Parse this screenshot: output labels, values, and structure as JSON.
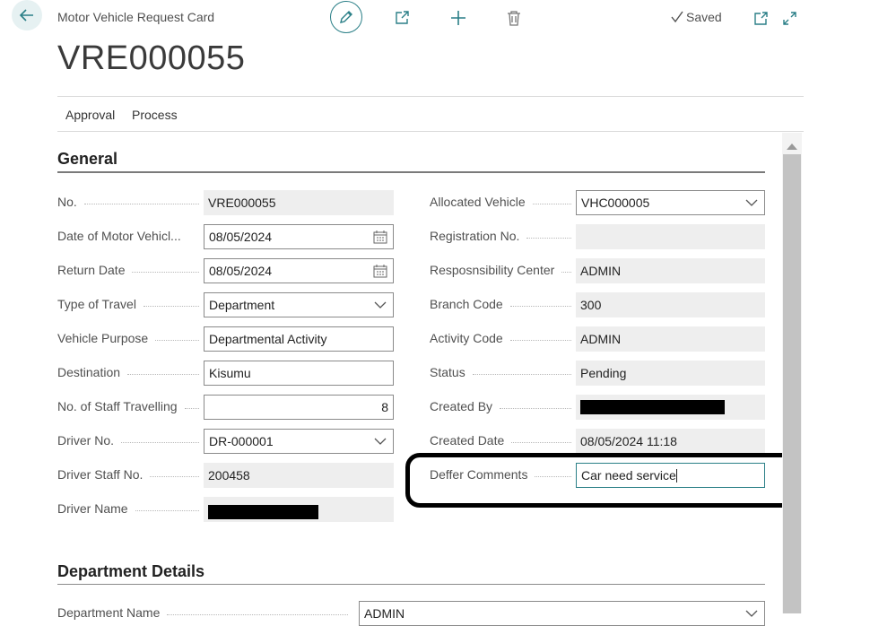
{
  "header": {
    "page_caption": "Motor Vehicle Request Card",
    "saved_label": "Saved",
    "record_title": "VRE000055"
  },
  "actions": {
    "approval": "Approval",
    "process": "Process"
  },
  "general": {
    "title": "General",
    "left": [
      {
        "label": "No.",
        "value": "VRE000055"
      },
      {
        "label": "Date of Motor Vehicl...",
        "value": "08/05/2024"
      },
      {
        "label": "Return Date",
        "value": "08/05/2024"
      },
      {
        "label": "Type of Travel",
        "value": "Department"
      },
      {
        "label": "Vehicle Purpose",
        "value": "Departmental Activity"
      },
      {
        "label": "Destination",
        "value": "Kisumu"
      },
      {
        "label": "No. of Staff Travelling",
        "value": "8"
      },
      {
        "label": "Driver No.",
        "value": "DR-000001"
      },
      {
        "label": "Driver Staff No.",
        "value": "200458"
      },
      {
        "label": "Driver Name",
        "value": ""
      }
    ],
    "right": [
      {
        "label": "Allocated Vehicle",
        "value": "VHC000005"
      },
      {
        "label": "Registration No.",
        "value": ""
      },
      {
        "label": "Resposnsibility Center",
        "value": "ADMIN"
      },
      {
        "label": "Branch Code",
        "value": "300"
      },
      {
        "label": "Activity Code",
        "value": "ADMIN"
      },
      {
        "label": "Status",
        "value": "Pending"
      },
      {
        "label": "Created By",
        "value": ""
      },
      {
        "label": "Created Date",
        "value": "08/05/2024 11:18"
      },
      {
        "label": "Deffer Comments",
        "value": "Car need service"
      }
    ]
  },
  "department": {
    "title": "Department Details",
    "name_label": "Department Name",
    "name_value": "ADMIN"
  },
  "icons": [
    "back-arrow-icon",
    "pencil-icon",
    "share-icon",
    "plus-icon",
    "trash-icon",
    "check-icon",
    "popout-icon",
    "expand-icon",
    "calendar-icon",
    "chevron-down-icon",
    "scroll-up-icon"
  ],
  "colors": {
    "accent": "#2a7f87",
    "readonly_bg": "#eeeeee"
  }
}
